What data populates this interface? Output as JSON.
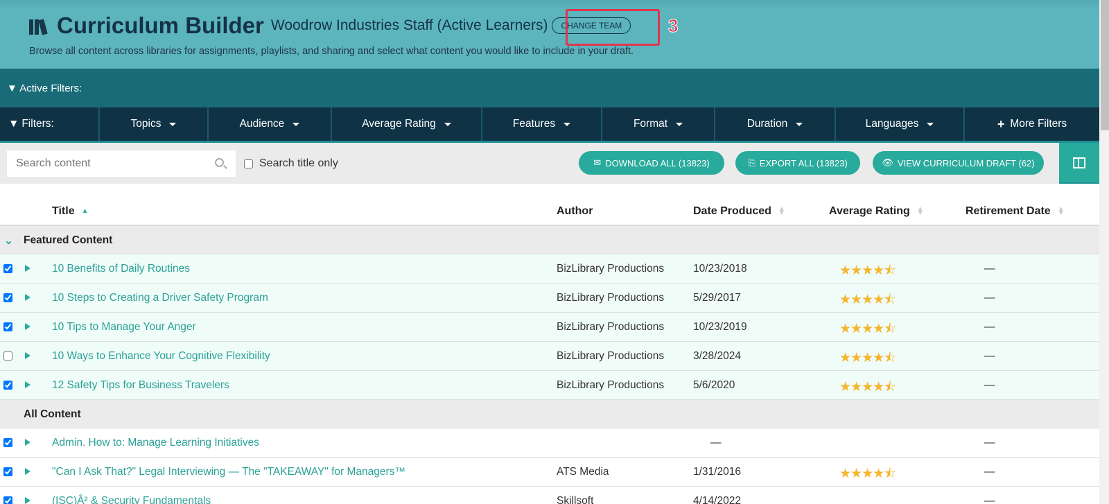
{
  "header": {
    "title": "Curriculum Builder",
    "team": "Woodrow Industries Staff (Active Learners)",
    "change_team": "CHANGE TEAM",
    "annotation": "3",
    "description": "Browse all content across libraries for assignments, playlists, and sharing and select what content you would like to include in your draft."
  },
  "active_filters": "Active Filters:",
  "filters": {
    "label": "Filters:",
    "items": [
      "Topics",
      "Audience",
      "Average Rating",
      "Features",
      "Format",
      "Duration",
      "Languages"
    ],
    "more": "More Filters"
  },
  "toolbar": {
    "search_placeholder": "Search content",
    "search_title_only": "Search title only",
    "download": "DOWNLOAD ALL (13823)",
    "export": "EXPORT ALL (13823)",
    "view_draft": "VIEW CURRICULUM DRAFT (62)"
  },
  "columns": [
    "Title",
    "Author",
    "Date Produced",
    "Average Rating",
    "Retirement Date"
  ],
  "groups": {
    "featured": "Featured Content",
    "all": "All Content"
  },
  "featured_rows": [
    {
      "title": "10 Benefits of Daily Routines",
      "author": "BizLibrary Productions",
      "date": "10/23/2018",
      "rating": 4.5,
      "retire": "—",
      "checked": true
    },
    {
      "title": "10 Steps to Creating a Driver Safety Program",
      "author": "BizLibrary Productions",
      "date": "5/29/2017",
      "rating": 4.5,
      "retire": "—",
      "checked": true
    },
    {
      "title": "10 Tips to Manage Your Anger",
      "author": "BizLibrary Productions",
      "date": "10/23/2019",
      "rating": 4.5,
      "retire": "—",
      "checked": true
    },
    {
      "title": "10 Ways to Enhance Your Cognitive Flexibility",
      "author": "BizLibrary Productions",
      "date": "3/28/2024",
      "rating": 4.5,
      "retire": "—",
      "checked": false
    },
    {
      "title": "12 Safety Tips for Business Travelers",
      "author": "BizLibrary Productions",
      "date": "5/6/2020",
      "rating": 4.5,
      "retire": "—",
      "checked": true
    }
  ],
  "all_rows": [
    {
      "title": "Admin. How to: Manage Learning Initiatives",
      "author": "",
      "date": "—",
      "rating": null,
      "retire": "—",
      "checked": true
    },
    {
      "title": "\"Can I Ask That?\" Legal Interviewing — The \"TAKEAWAY\" for Managers™",
      "author": "ATS Media",
      "date": "1/31/2016",
      "rating": 4.5,
      "retire": "—",
      "checked": true
    },
    {
      "title": "(ISC)Â² & Security Fundamentals",
      "author": "Skillsoft",
      "date": "4/14/2022",
      "rating": null,
      "retire": "—",
      "checked": true
    }
  ]
}
